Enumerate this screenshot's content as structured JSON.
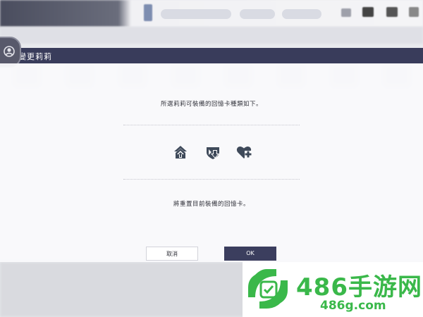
{
  "dialog": {
    "title": "變更莉莉",
    "message_top": "所選莉莉可裝備的回憶卡種類如下。",
    "message_bottom": "將重置目前裝備的回憶卡。",
    "memory_card_types": [
      "attack-up-icon",
      "defense-down-icon",
      "heal-icon"
    ],
    "cancel_label": "取消",
    "ok_label": "OK"
  },
  "watermark": {
    "brand": "486手游网",
    "url": "486g.com"
  },
  "colors": {
    "header": "#393c5b",
    "ok_button": "#3b3e5e",
    "watermark_green": "#3ab84a",
    "icon": "#3f4a5a"
  }
}
